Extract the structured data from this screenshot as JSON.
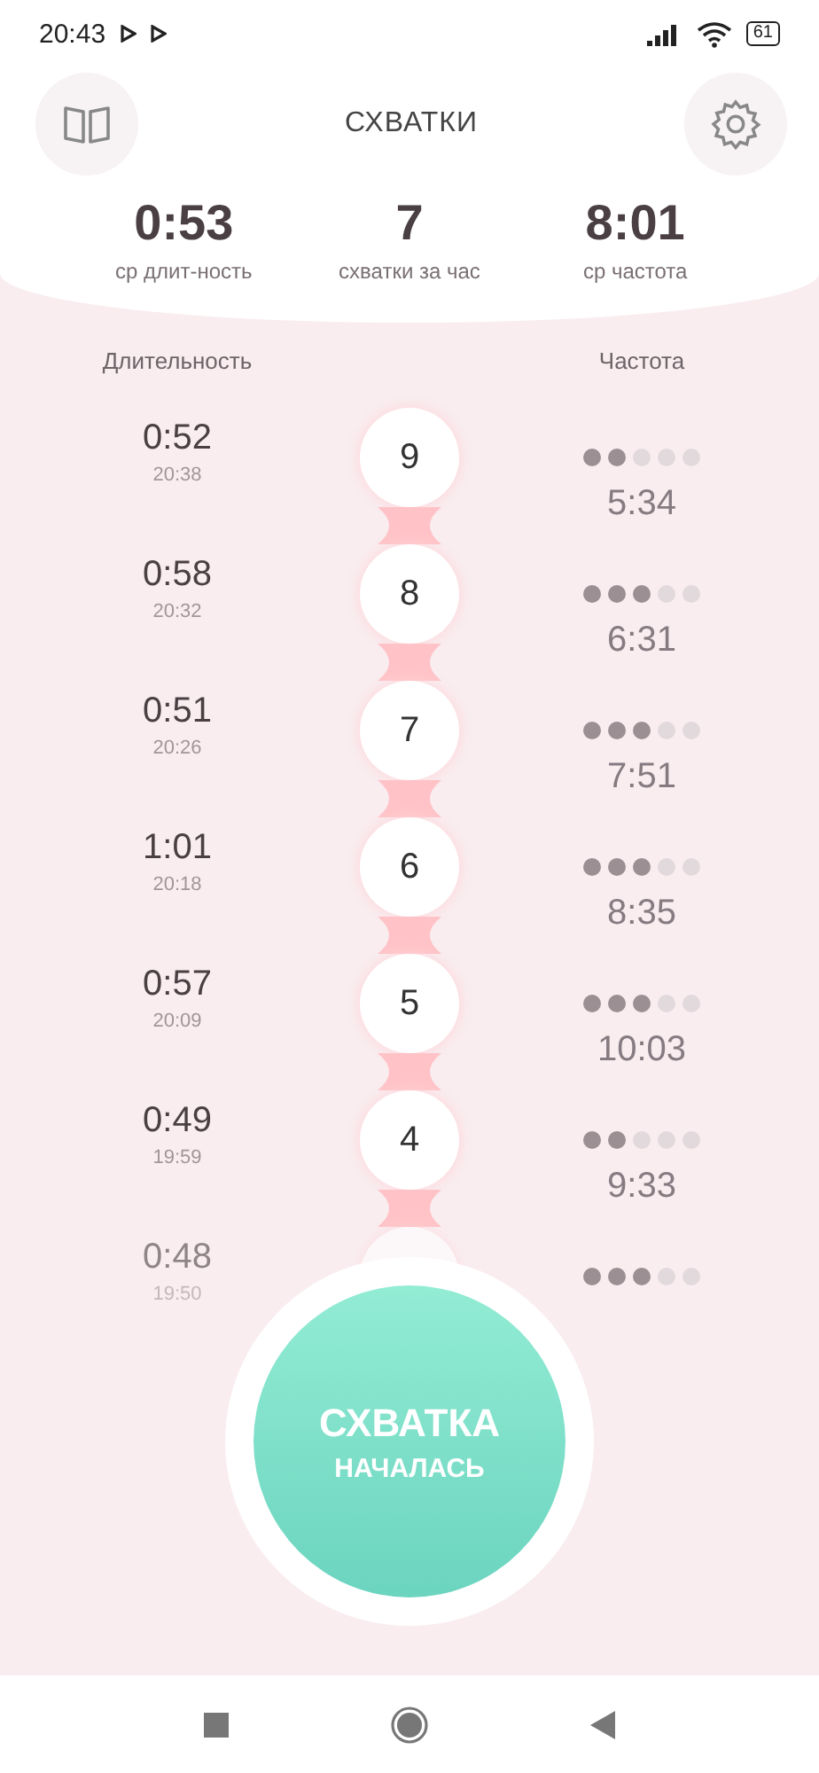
{
  "status_bar": {
    "time": "20:43",
    "battery": "61"
  },
  "header": {
    "title": "СХВАТКИ"
  },
  "stats": [
    {
      "value": "0:53",
      "label": "ср длит-ность"
    },
    {
      "value": "7",
      "label": "схватки за час"
    },
    {
      "value": "8:01",
      "label": "ср частота"
    }
  ],
  "columns": {
    "duration": "Длительность",
    "frequency": "Частота"
  },
  "contractions": [
    {
      "number": "9",
      "duration": "0:52",
      "time": "20:38",
      "stars": 2,
      "frequency": "5:34",
      "faded": false
    },
    {
      "number": "8",
      "duration": "0:58",
      "time": "20:32",
      "stars": 3,
      "frequency": "6:31",
      "faded": false
    },
    {
      "number": "7",
      "duration": "0:51",
      "time": "20:26",
      "stars": 3,
      "frequency": "7:51",
      "faded": false
    },
    {
      "number": "6",
      "duration": "1:01",
      "time": "20:18",
      "stars": 3,
      "frequency": "8:35",
      "faded": false
    },
    {
      "number": "5",
      "duration": "0:57",
      "time": "20:09",
      "stars": 3,
      "frequency": "10:03",
      "faded": false
    },
    {
      "number": "4",
      "duration": "0:49",
      "time": "19:59",
      "stars": 2,
      "frequency": "9:33",
      "faded": false
    },
    {
      "duration": "0:48",
      "time": "19:50",
      "stars": 3,
      "faded": true
    }
  ],
  "start_button": {
    "line_1": "СХВАТКА",
    "line_2": "НАЧАЛАСЬ"
  }
}
